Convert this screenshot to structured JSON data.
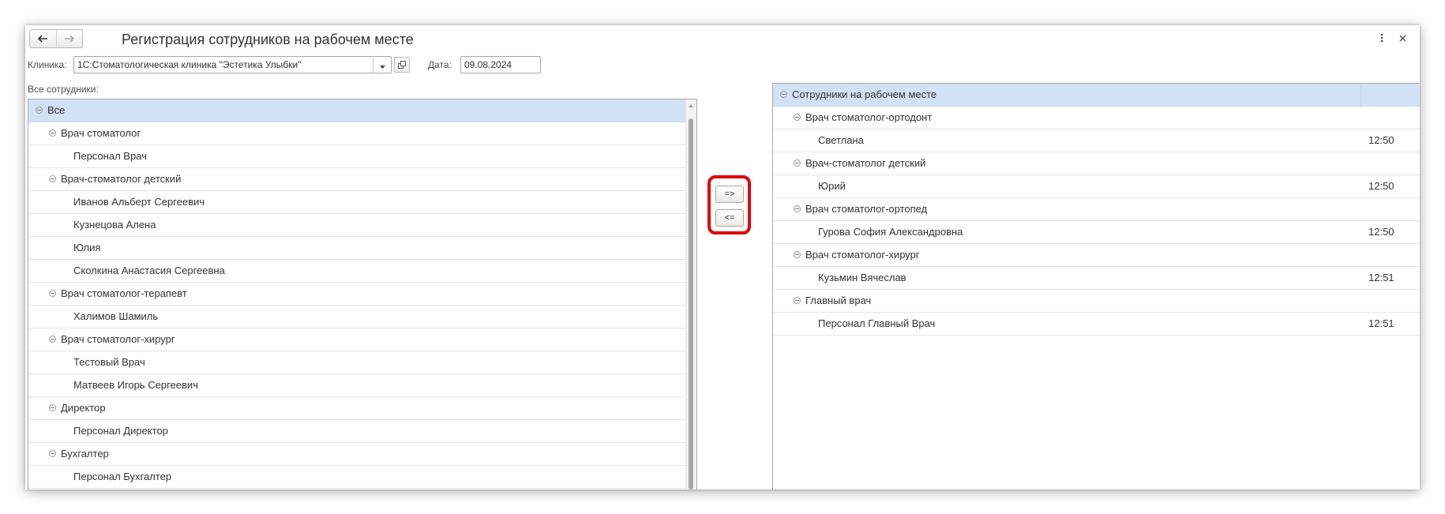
{
  "window": {
    "title": "Регистрация сотрудников на рабочем месте",
    "back_icon": "arrow-left-icon",
    "forward_icon": "arrow-right-icon",
    "more_icon": "more-vertical-icon",
    "close_icon": "close-icon"
  },
  "filters": {
    "clinic_label": "Клиника:",
    "clinic_value": "1С:Стоматологическая клиника \"Эстетика Улыбки\"",
    "date_label": "Дата:",
    "date_value": "09.08.2024"
  },
  "all_employees": {
    "label": "Все сотрудники:",
    "rows": [
      {
        "text": "Все",
        "level": 0,
        "group": true,
        "selected": true
      },
      {
        "text": "Врач стоматолог",
        "level": 1,
        "group": true
      },
      {
        "text": "Персонал Врач",
        "level": 2
      },
      {
        "text": "Врач-стоматолог детский",
        "level": 1,
        "group": true
      },
      {
        "text": "Иванов Альберт Сергеевич",
        "level": 2
      },
      {
        "text": "Кузнецова Алена",
        "level": 2
      },
      {
        "text": "Юлия",
        "level": 2
      },
      {
        "text": "Сколкина Анастасия Сергеевна",
        "level": 2
      },
      {
        "text": "Врач стоматолог-терапевт",
        "level": 1,
        "group": true
      },
      {
        "text": "Халимов Шамиль",
        "level": 2
      },
      {
        "text": "Врач стоматолог-хирург",
        "level": 1,
        "group": true
      },
      {
        "text": "Тестовый Врач",
        "level": 2
      },
      {
        "text": "Матвеев Игорь Сергеевич",
        "level": 2
      },
      {
        "text": "Директор",
        "level": 1,
        "group": true
      },
      {
        "text": "Персонал Директор",
        "level": 2
      },
      {
        "text": "Бухгалтер",
        "level": 1,
        "group": true
      },
      {
        "text": "Персонал Бухгалтер",
        "level": 2
      }
    ]
  },
  "buttons": {
    "add": "=>",
    "remove": "<="
  },
  "at_workplace": {
    "rows": [
      {
        "text": "Сотрудники на рабочем месте",
        "level": 0,
        "group": true,
        "selected": true,
        "time": ""
      },
      {
        "text": "Врач стоматолог-ортодонт",
        "level": 1,
        "group": true,
        "time": ""
      },
      {
        "text": "Светлана",
        "level": 2,
        "time": "12:50"
      },
      {
        "text": "Врач-стоматолог детский",
        "level": 1,
        "group": true,
        "time": ""
      },
      {
        "text": "Юрий",
        "level": 2,
        "time": "12:50"
      },
      {
        "text": "Врач стоматолог-ортопед",
        "level": 1,
        "group": true,
        "time": ""
      },
      {
        "text": "Гурова София Александровна",
        "level": 2,
        "time": "12:50"
      },
      {
        "text": "Врач стоматолог-хирург",
        "level": 1,
        "group": true,
        "time": ""
      },
      {
        "text": "Кузьмин Вячеслав",
        "level": 2,
        "time": "12:51"
      },
      {
        "text": "Главный врач",
        "level": 1,
        "group": true,
        "time": ""
      },
      {
        "text": "Персонал Главный Врач",
        "level": 2,
        "time": "12:51"
      }
    ]
  }
}
